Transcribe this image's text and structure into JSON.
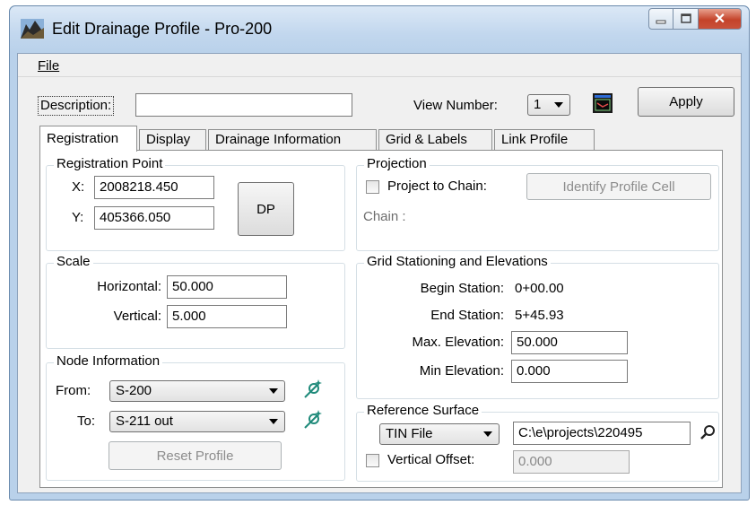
{
  "window": {
    "title": "Edit Drainage Profile - Pro-200",
    "icon": "drainage-profile-app-icon",
    "controls": {
      "minimize": "minimize-icon",
      "maximize": "maximize-icon",
      "close": "✕"
    }
  },
  "menu": {
    "file": "File"
  },
  "toolbar": {
    "description_label": "Description:",
    "description_value": "",
    "view_number_label": "View Number:",
    "view_number_value": "1",
    "view_icon": "view-window-icon",
    "apply_label": "Apply"
  },
  "tabs": [
    {
      "label": "Registration",
      "active": true
    },
    {
      "label": "Display",
      "active": false
    },
    {
      "label": "Drainage Information",
      "active": false
    },
    {
      "label": "Grid & Labels",
      "active": false
    },
    {
      "label": "Link Profile",
      "active": false
    }
  ],
  "registration_point": {
    "title": "Registration Point",
    "x_label": "X:",
    "x_value": "2008218.450",
    "y_label": "Y:",
    "y_value": "405366.050",
    "dp_label": "DP"
  },
  "projection": {
    "title": "Projection",
    "project_to_chain_label": "Project to Chain:",
    "project_to_chain_checked": false,
    "identify_button": "Identify Profile Cell",
    "chain_label": "Chain :"
  },
  "scale": {
    "title": "Scale",
    "horizontal_label": "Horizontal:",
    "horizontal_value": "50.000",
    "vertical_label": "Vertical:",
    "vertical_value": "5.000"
  },
  "grid": {
    "title": "Grid Stationing and Elevations",
    "begin_label": "Begin Station:",
    "begin_value": "0+00.00",
    "end_label": "End Station:",
    "end_value": "5+45.93",
    "max_label": "Max. Elevation:",
    "max_value": "50.000",
    "min_label": "Min Elevation:",
    "min_value": "0.000"
  },
  "node_info": {
    "title": "Node Information",
    "from_label": "From:",
    "from_value": "S-200",
    "to_label": "To:",
    "to_value": "S-211 out",
    "reset_label": "Reset Profile",
    "pick_icon": "node-pick-icon"
  },
  "reference_surface": {
    "title": "Reference Surface",
    "type_value": "TIN File",
    "path_value": "C:\\e\\projects\\220495",
    "browse_icon": "magnifier-icon",
    "vertical_offset_label": "Vertical Offset:",
    "vertical_offset_checked": false,
    "vertical_offset_value": "0.000"
  },
  "colors": {
    "accent": "#b9d1ea",
    "close_button": "#c4432a",
    "pick_icon": "#1f8a7a"
  }
}
